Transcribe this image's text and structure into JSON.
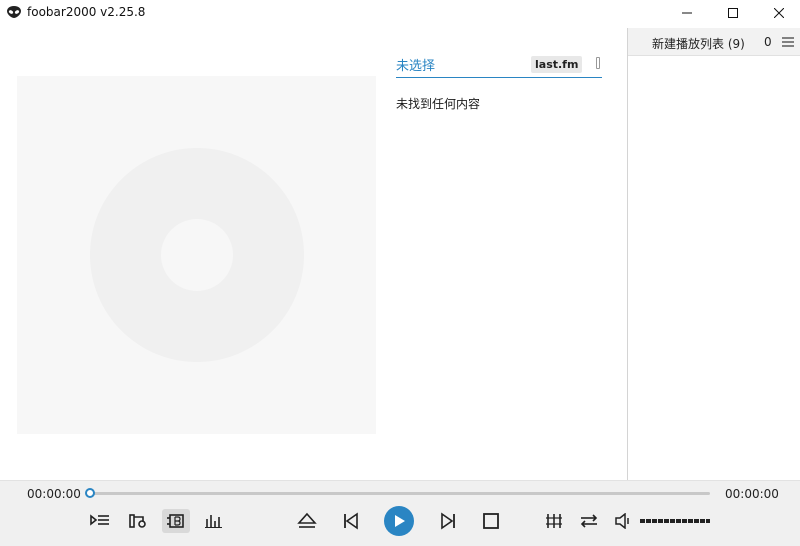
{
  "window": {
    "title": "foobar2000 v2.25.8"
  },
  "info_panel": {
    "tab_label": "未选择",
    "badge": "last.fm",
    "empty_message": "未找到任何内容"
  },
  "playlist": {
    "name": "新建播放列表 (9)",
    "count": "0"
  },
  "transport": {
    "elapsed": "00:00:00",
    "total": "00:00:00",
    "seek_position": 0
  },
  "colors": {
    "accent": "#2a85c3",
    "art_bg": "#f7f7f7",
    "disc": "#f0f0f0"
  }
}
